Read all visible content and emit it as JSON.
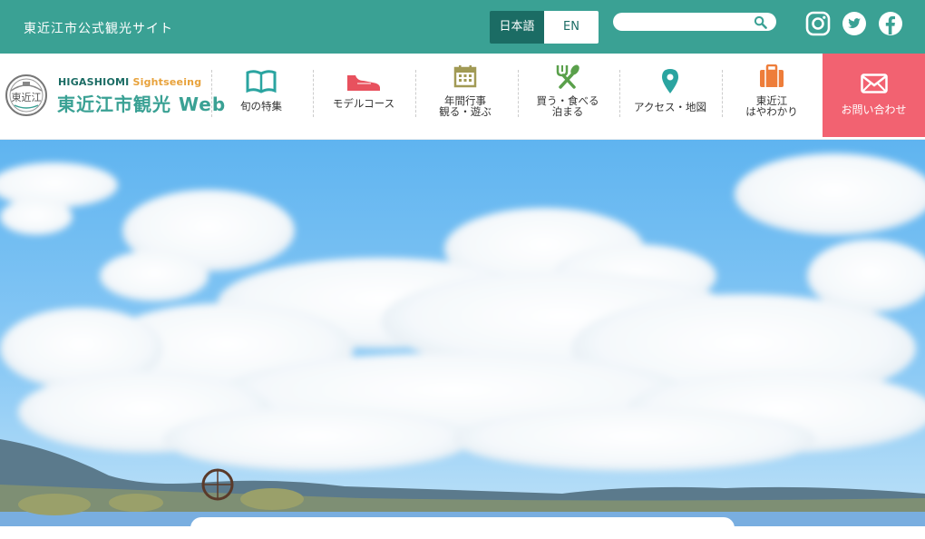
{
  "header": {
    "site_title": "東近江市公式観光サイト",
    "languages": [
      {
        "label": "日本語",
        "active": true
      },
      {
        "label": "EN",
        "active": false
      }
    ],
    "search": {
      "placeholder": "",
      "icon": "search-icon"
    },
    "social": [
      {
        "name": "instagram-icon"
      },
      {
        "name": "twitter-icon"
      },
      {
        "name": "facebook-icon"
      }
    ]
  },
  "logo": {
    "sub_part1": "HIGASHIOMI",
    "sub_part2": "Sightseeing",
    "main": "東近江市観光 Web",
    "emblem_text": "東近江"
  },
  "nav": {
    "items": [
      {
        "label": "旬の特集",
        "icon": "book-icon"
      },
      {
        "label": "モデルコース",
        "icon": "shoe-icon"
      },
      {
        "label": "年間行事\n観る・遊ぶ",
        "icon": "calendar-icon"
      },
      {
        "label": "買う・食べる\n泊まる",
        "icon": "utensils-icon"
      },
      {
        "label": "アクセス・地図",
        "icon": "map-pin-icon"
      },
      {
        "label": "東近江\nはやわかり",
        "icon": "suitcase-icon"
      }
    ],
    "contact": {
      "label": "お問い合わせ",
      "icon": "mail-icon"
    }
  },
  "colors": {
    "brand": "#3aa194",
    "brand_dark": "#1b6c64",
    "accent": "#f26271",
    "icon_teal": "#2aa4a0",
    "icon_red": "#e8515e",
    "icon_olive": "#a19a55",
    "icon_green": "#5aa04b",
    "icon_orange": "#ee7d3a"
  }
}
